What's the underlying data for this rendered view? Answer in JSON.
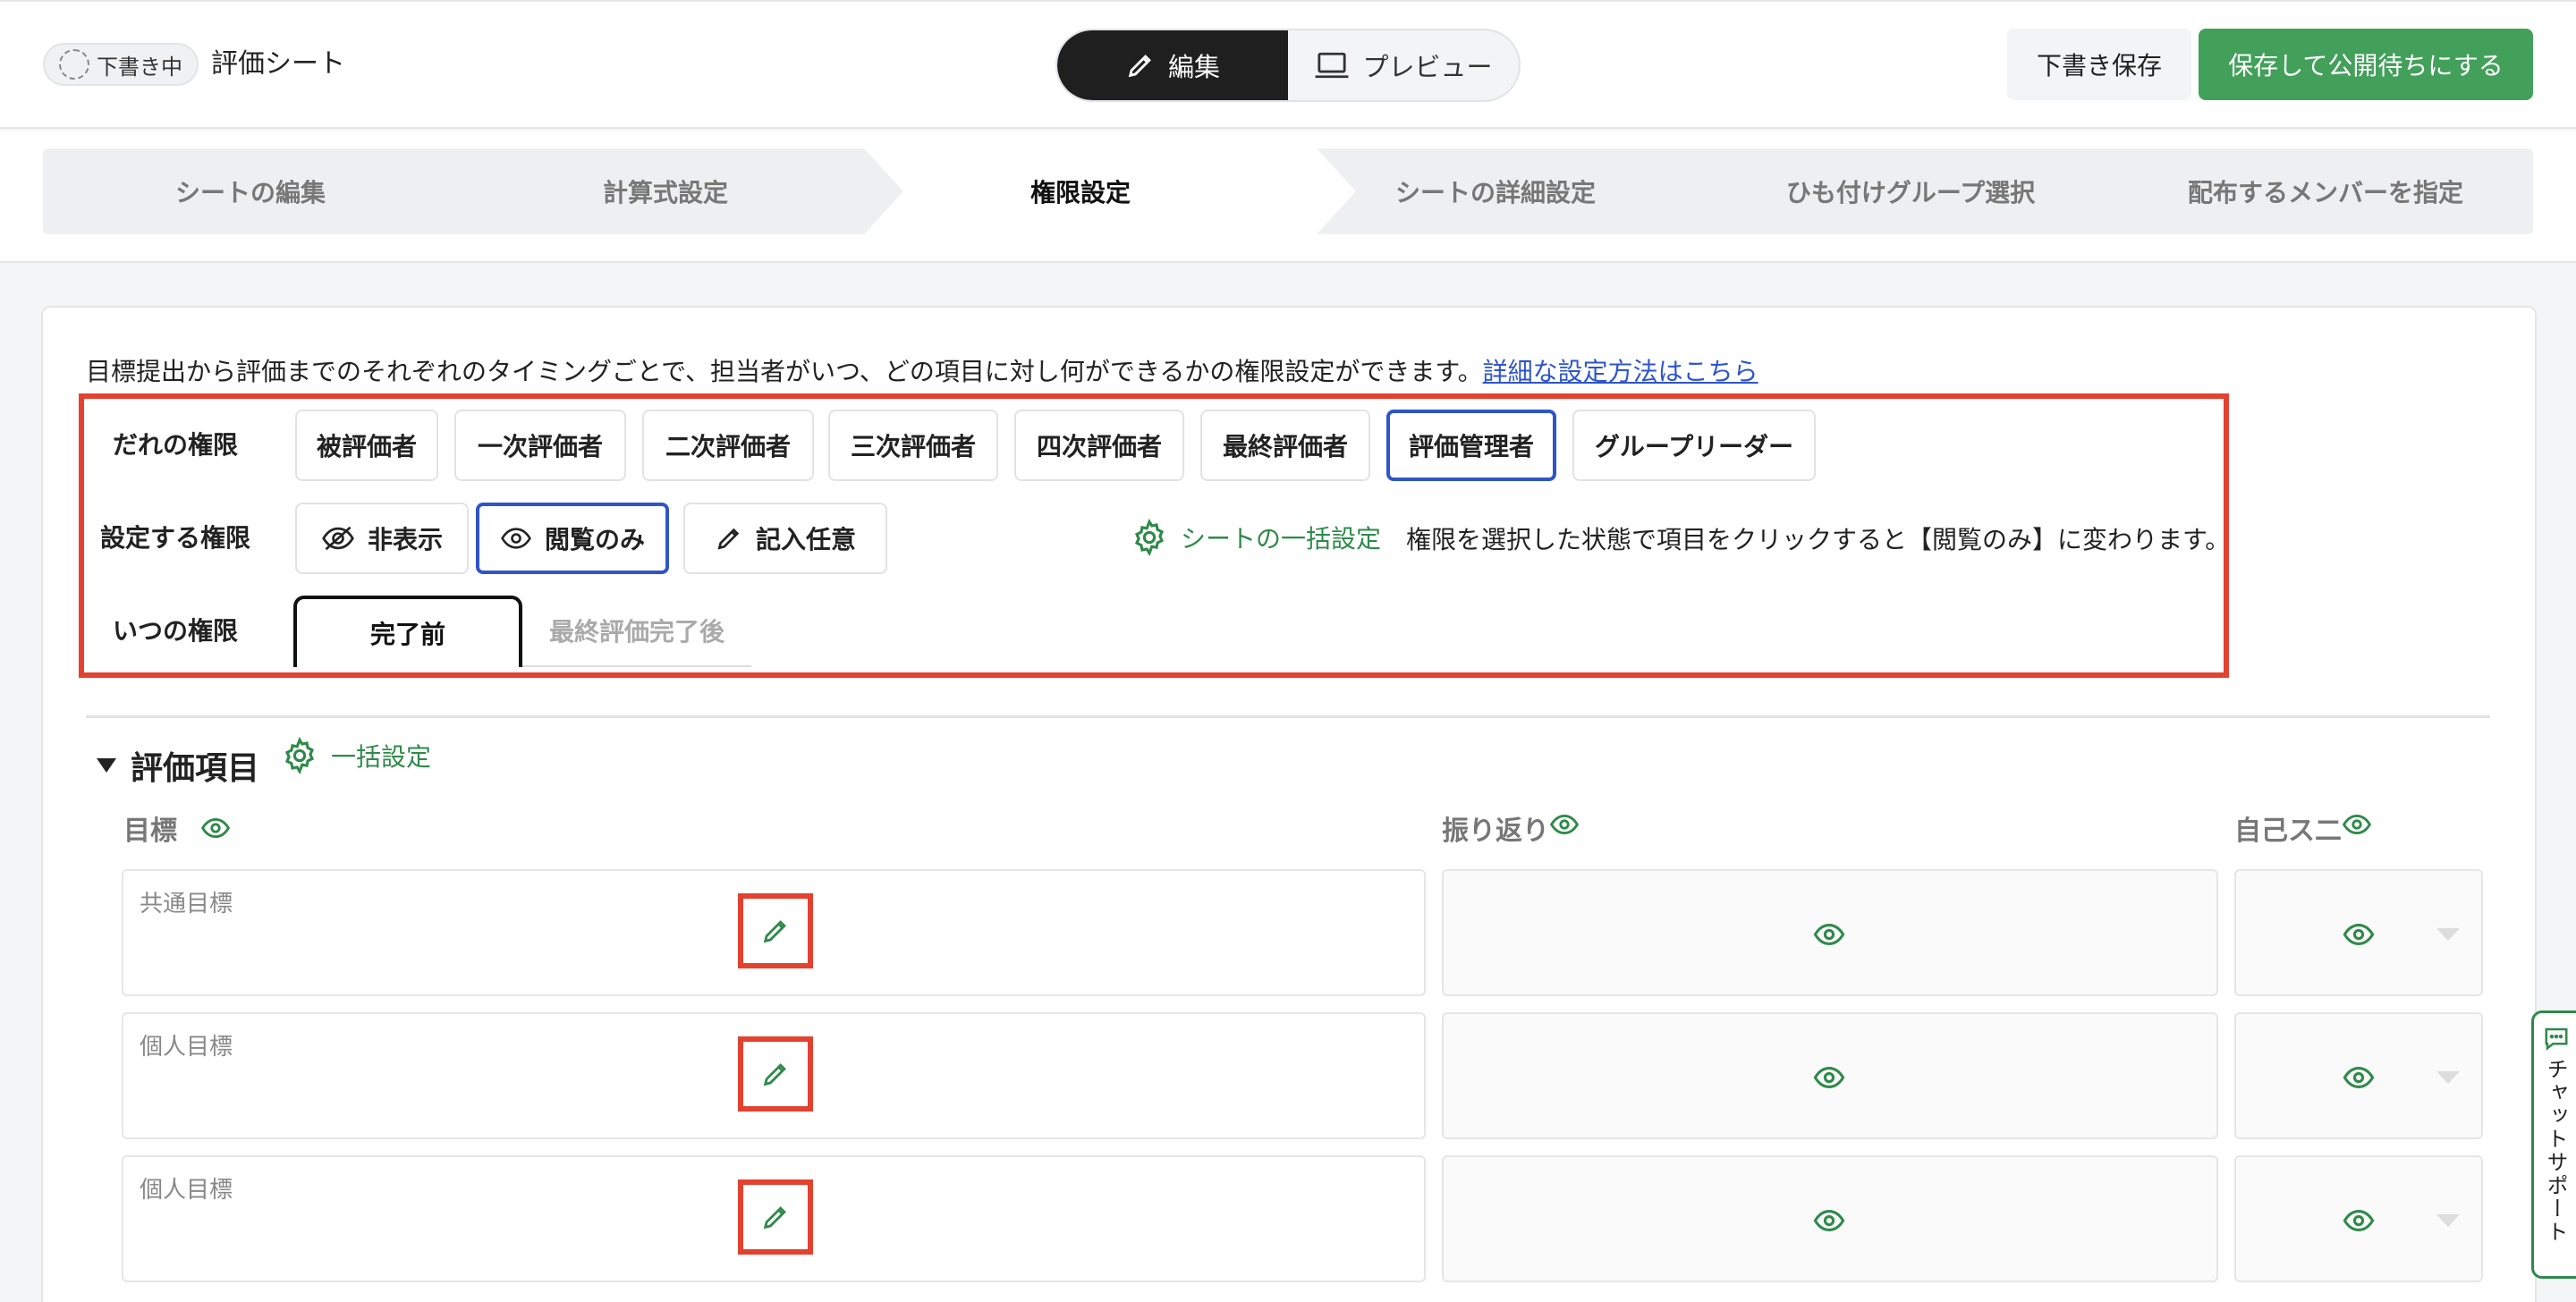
{
  "header": {
    "status_badge": "下書き中",
    "sheet_title": "評価シート",
    "mode_edit": "編集",
    "mode_preview": "プレビュー",
    "save_draft": "下書き保存",
    "save_publish": "保存して公開待ちにする"
  },
  "steps": [
    "シートの編集",
    "計算式設定",
    "権限設定",
    "シートの詳細設定",
    "ひも付けグループ選択",
    "配布するメンバーを指定"
  ],
  "intro": {
    "text": "目標提出から評価までのそれぞれのタイミングごとで、担当者がいつ、どの項目に対し何ができるかの権限設定ができます。",
    "link": "詳細な設定方法はこちら"
  },
  "who": {
    "label": "だれの権限",
    "options": [
      "被評価者",
      "一次評価者",
      "二次評価者",
      "三次評価者",
      "四次評価者",
      "最終評価者",
      "評価管理者",
      "グループリーダー"
    ],
    "selected": "評価管理者"
  },
  "perm": {
    "label": "設定する権限",
    "options": [
      "非表示",
      "閲覧のみ",
      "記入任意"
    ],
    "selected": "閲覧のみ",
    "bulk": "シートの一括設定",
    "hint": "権限を選択した状態で項目をクリックすると【閲覧のみ】に変わります。"
  },
  "when": {
    "label": "いつの権限",
    "tabs": [
      "完了前",
      "最終評価完了後"
    ],
    "selected": "完了前"
  },
  "section": {
    "title": "評価項目",
    "bulk": "一括設定",
    "col_goal": "目標",
    "col_reflect": "振り返り",
    "col_self": "自己ス二",
    "rows": [
      {
        "label": "共通目標"
      },
      {
        "label": "個人目標"
      },
      {
        "label": "個人目標"
      }
    ]
  },
  "chat": "チャットサポート",
  "colors": {
    "accent_green": "#43a05b",
    "selected_blue": "#2f55c9",
    "highlight_red": "#e2422f"
  }
}
